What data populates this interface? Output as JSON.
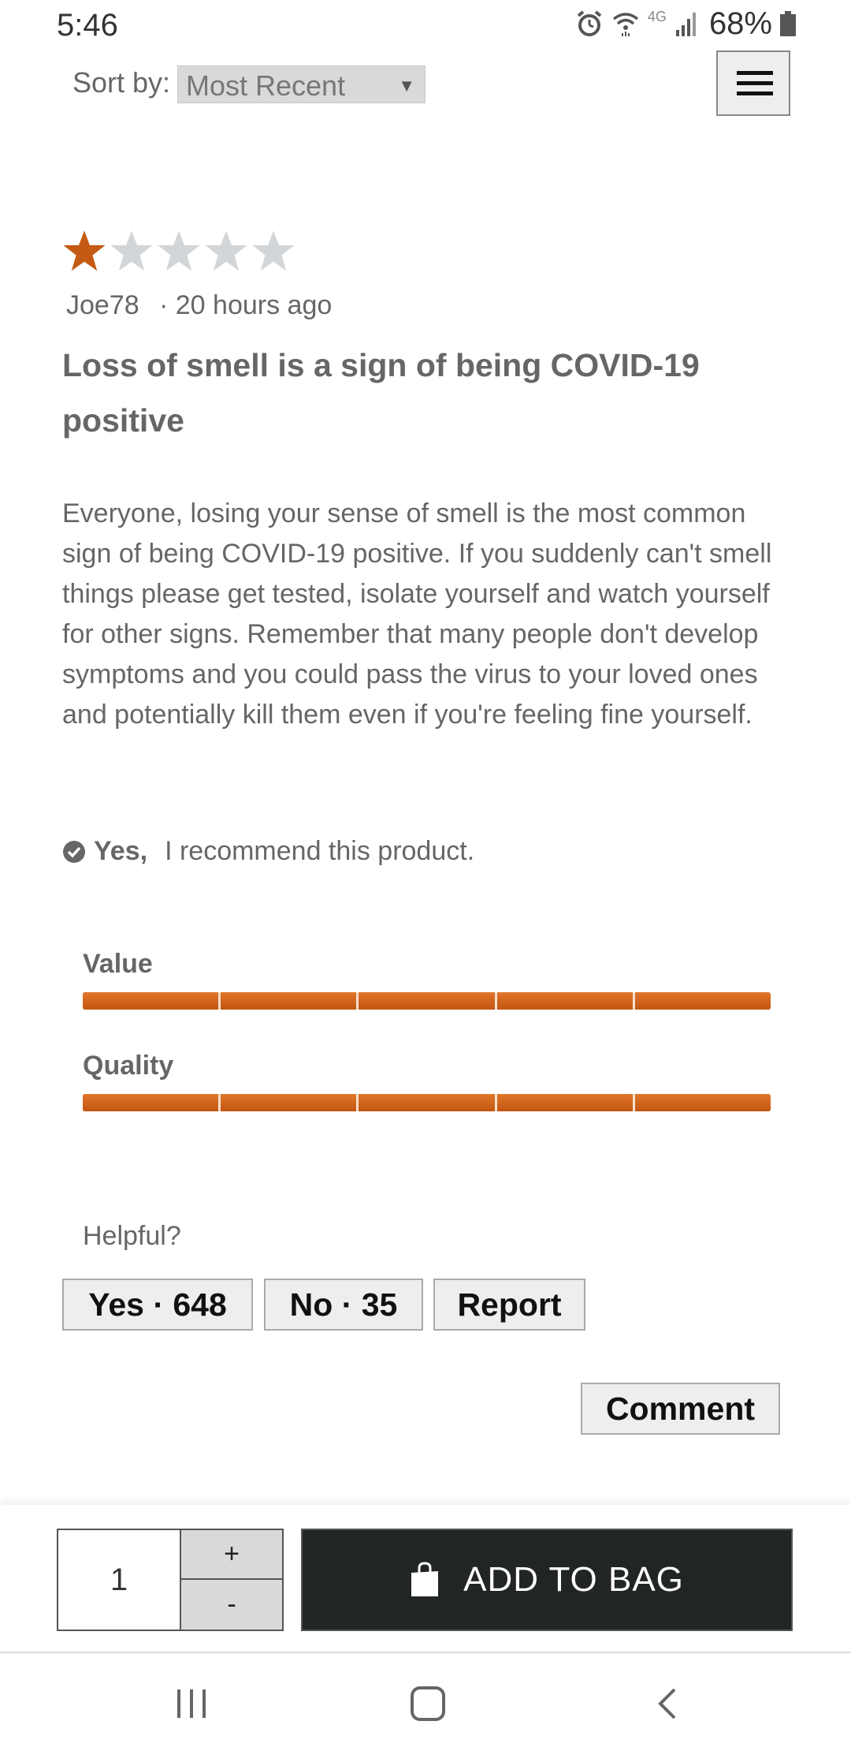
{
  "status_bar": {
    "time": "5:46",
    "network": "4G",
    "battery": "68%"
  },
  "sort": {
    "label": "Sort by:",
    "selected": "Most Recent"
  },
  "review": {
    "rating": 1,
    "max_rating": 5,
    "star_filled_color": "#c45a14",
    "star_empty_color": "#d3d6d8",
    "reviewer": "Joe78",
    "time": "· 20 hours ago",
    "title": "Loss of smell is a sign of being COVID-19 positive",
    "body": "Everyone, losing your sense of smell is the most common sign of being COVID-19 positive. If you suddenly can't smell things please get tested, isolate yourself and watch yourself for other signs. Remember that many people don't develop symptoms and you could pass the virus to your loved ones and potentially kill them even if you're feeling fine yourself.",
    "recommend_yes": "Yes,",
    "recommend_text": "I recommend this product.",
    "ratings": [
      {
        "label": "Value",
        "score": 5,
        "max": 5
      },
      {
        "label": "Quality",
        "score": 5,
        "max": 5
      }
    ],
    "helpful_label": "Helpful?",
    "yes_button": "Yes · 648",
    "no_button": "No · 35",
    "report_button": "Report",
    "comment_button": "Comment"
  },
  "purchase": {
    "quantity": "1",
    "plus": "+",
    "minus": "-",
    "add_to_bag": "ADD TO BAG"
  },
  "accent_color": "#c45a14"
}
